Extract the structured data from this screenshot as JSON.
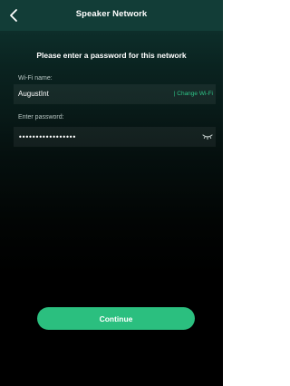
{
  "header": {
    "title": "Speaker Network",
    "back_icon": "chevron-left-icon"
  },
  "main": {
    "prompt": "Please enter a password for this network",
    "wifi": {
      "label": "Wi-Fi name:",
      "value": "AugustInt",
      "change_link": "| Change Wi-Fi"
    },
    "password": {
      "label": "Enter password:",
      "value": "•••••••••••••••••",
      "toggle_icon": "eye-closed-icon"
    },
    "continue_label": "Continue"
  },
  "colors": {
    "header_bg": "#123d37",
    "accent": "#2bbf7f",
    "link": "#2ec487"
  }
}
